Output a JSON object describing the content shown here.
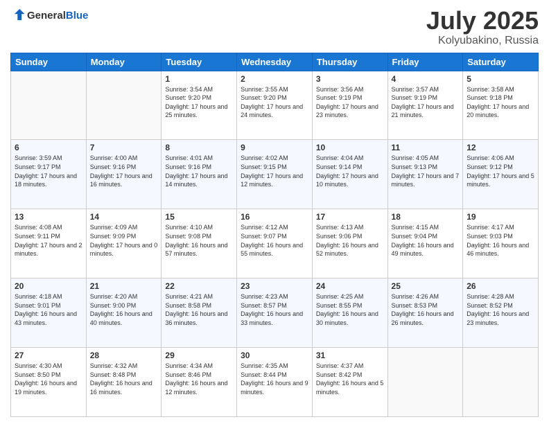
{
  "logo": {
    "general": "General",
    "blue": "Blue"
  },
  "header": {
    "title": "July 2025",
    "subtitle": "Kolyubakino, Russia"
  },
  "weekdays": [
    "Sunday",
    "Monday",
    "Tuesday",
    "Wednesday",
    "Thursday",
    "Friday",
    "Saturday"
  ],
  "weeks": [
    [
      {
        "day": "",
        "info": ""
      },
      {
        "day": "",
        "info": ""
      },
      {
        "day": "1",
        "info": "Sunrise: 3:54 AM\nSunset: 9:20 PM\nDaylight: 17 hours and 25 minutes."
      },
      {
        "day": "2",
        "info": "Sunrise: 3:55 AM\nSunset: 9:20 PM\nDaylight: 17 hours and 24 minutes."
      },
      {
        "day": "3",
        "info": "Sunrise: 3:56 AM\nSunset: 9:19 PM\nDaylight: 17 hours and 23 minutes."
      },
      {
        "day": "4",
        "info": "Sunrise: 3:57 AM\nSunset: 9:19 PM\nDaylight: 17 hours and 21 minutes."
      },
      {
        "day": "5",
        "info": "Sunrise: 3:58 AM\nSunset: 9:18 PM\nDaylight: 17 hours and 20 minutes."
      }
    ],
    [
      {
        "day": "6",
        "info": "Sunrise: 3:59 AM\nSunset: 9:17 PM\nDaylight: 17 hours and 18 minutes."
      },
      {
        "day": "7",
        "info": "Sunrise: 4:00 AM\nSunset: 9:16 PM\nDaylight: 17 hours and 16 minutes."
      },
      {
        "day": "8",
        "info": "Sunrise: 4:01 AM\nSunset: 9:16 PM\nDaylight: 17 hours and 14 minutes."
      },
      {
        "day": "9",
        "info": "Sunrise: 4:02 AM\nSunset: 9:15 PM\nDaylight: 17 hours and 12 minutes."
      },
      {
        "day": "10",
        "info": "Sunrise: 4:04 AM\nSunset: 9:14 PM\nDaylight: 17 hours and 10 minutes."
      },
      {
        "day": "11",
        "info": "Sunrise: 4:05 AM\nSunset: 9:13 PM\nDaylight: 17 hours and 7 minutes."
      },
      {
        "day": "12",
        "info": "Sunrise: 4:06 AM\nSunset: 9:12 PM\nDaylight: 17 hours and 5 minutes."
      }
    ],
    [
      {
        "day": "13",
        "info": "Sunrise: 4:08 AM\nSunset: 9:11 PM\nDaylight: 17 hours and 2 minutes."
      },
      {
        "day": "14",
        "info": "Sunrise: 4:09 AM\nSunset: 9:09 PM\nDaylight: 17 hours and 0 minutes."
      },
      {
        "day": "15",
        "info": "Sunrise: 4:10 AM\nSunset: 9:08 PM\nDaylight: 16 hours and 57 minutes."
      },
      {
        "day": "16",
        "info": "Sunrise: 4:12 AM\nSunset: 9:07 PM\nDaylight: 16 hours and 55 minutes."
      },
      {
        "day": "17",
        "info": "Sunrise: 4:13 AM\nSunset: 9:06 PM\nDaylight: 16 hours and 52 minutes."
      },
      {
        "day": "18",
        "info": "Sunrise: 4:15 AM\nSunset: 9:04 PM\nDaylight: 16 hours and 49 minutes."
      },
      {
        "day": "19",
        "info": "Sunrise: 4:17 AM\nSunset: 9:03 PM\nDaylight: 16 hours and 46 minutes."
      }
    ],
    [
      {
        "day": "20",
        "info": "Sunrise: 4:18 AM\nSunset: 9:01 PM\nDaylight: 16 hours and 43 minutes."
      },
      {
        "day": "21",
        "info": "Sunrise: 4:20 AM\nSunset: 9:00 PM\nDaylight: 16 hours and 40 minutes."
      },
      {
        "day": "22",
        "info": "Sunrise: 4:21 AM\nSunset: 8:58 PM\nDaylight: 16 hours and 36 minutes."
      },
      {
        "day": "23",
        "info": "Sunrise: 4:23 AM\nSunset: 8:57 PM\nDaylight: 16 hours and 33 minutes."
      },
      {
        "day": "24",
        "info": "Sunrise: 4:25 AM\nSunset: 8:55 PM\nDaylight: 16 hours and 30 minutes."
      },
      {
        "day": "25",
        "info": "Sunrise: 4:26 AM\nSunset: 8:53 PM\nDaylight: 16 hours and 26 minutes."
      },
      {
        "day": "26",
        "info": "Sunrise: 4:28 AM\nSunset: 8:52 PM\nDaylight: 16 hours and 23 minutes."
      }
    ],
    [
      {
        "day": "27",
        "info": "Sunrise: 4:30 AM\nSunset: 8:50 PM\nDaylight: 16 hours and 19 minutes."
      },
      {
        "day": "28",
        "info": "Sunrise: 4:32 AM\nSunset: 8:48 PM\nDaylight: 16 hours and 16 minutes."
      },
      {
        "day": "29",
        "info": "Sunrise: 4:34 AM\nSunset: 8:46 PM\nDaylight: 16 hours and 12 minutes."
      },
      {
        "day": "30",
        "info": "Sunrise: 4:35 AM\nSunset: 8:44 PM\nDaylight: 16 hours and 9 minutes."
      },
      {
        "day": "31",
        "info": "Sunrise: 4:37 AM\nSunset: 8:42 PM\nDaylight: 16 hours and 5 minutes."
      },
      {
        "day": "",
        "info": ""
      },
      {
        "day": "",
        "info": ""
      }
    ]
  ]
}
